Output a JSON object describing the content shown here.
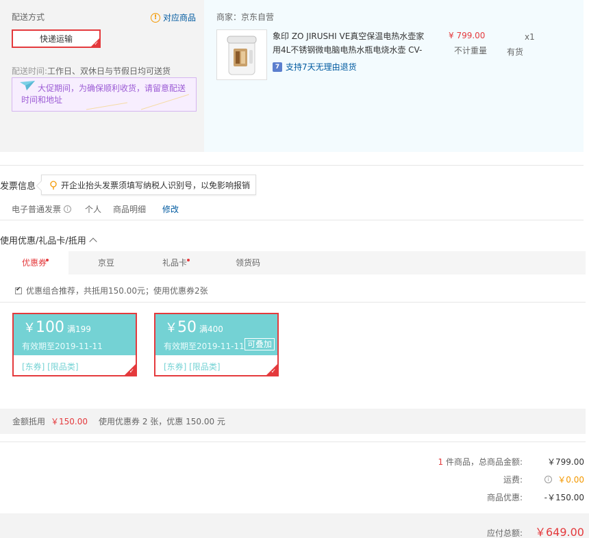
{
  "delivery": {
    "title": "配送方式",
    "match_link": "对应商品",
    "option": "快递运输",
    "time_label": "配送时间:",
    "time_value": "工作日、双休日与节假日均可送货",
    "promo_notice": "大促期间，为确保顺利收货，请留意配送时间和地址"
  },
  "product": {
    "seller": "商家：京东自营",
    "name": "象印 ZO JIRUSHI VE真空保温电热水壶家用4L不锈钢微电脑电热水瓶电烧水壶 CV-",
    "price": "¥ 799.00",
    "weight": "不计重量",
    "qty": "x1",
    "stock": "有货",
    "return_policy": "支持7天无理由退货",
    "return_badge": "7"
  },
  "invoice": {
    "title": "发票信息",
    "tip": "开企业抬头发票须填写纳税人识别号，以免影响报销",
    "type": "电子普通发票",
    "info_glyph": "i",
    "personal": "个人",
    "detail": "商品明细",
    "edit": "修改"
  },
  "coupons": {
    "title": "使用优惠/礼品卡/抵用",
    "tabs": [
      {
        "label": "优惠券",
        "active": true,
        "dot": true
      },
      {
        "label": "京豆",
        "active": false,
        "dot": false
      },
      {
        "label": "礼品卡",
        "active": false,
        "dot": true
      },
      {
        "label": "领货码",
        "active": false,
        "dot": false
      }
    ],
    "combo_text": "优惠组合推荐，共抵用150.00元；使用优惠券2张",
    "items": [
      {
        "yen": "￥",
        "amount": "100",
        "cond": "满199",
        "valid": "有效期至2019-11-11",
        "stack": "",
        "tags": "[东券]  [限品类]"
      },
      {
        "yen": "￥",
        "amount": "50",
        "cond": "满400",
        "valid": "有效期至2019-11-11",
        "stack": "可叠加",
        "tags": "[东券]  [限品类]"
      }
    ],
    "summary_label": "金额抵用",
    "summary_amount": "￥150.00",
    "summary_desc": "使用优惠券 2 张，优惠 150.00 元"
  },
  "totals": {
    "count": "1",
    "count_suffix": "件商品，总商品金额:",
    "goods_amount": "￥799.00",
    "freight_label": "运费:",
    "freight_value": "￥0.00",
    "discount_label": "商品优惠:",
    "discount_value": "-￥150.00",
    "payable_label": "应付总额:",
    "payable_value": "￥649.00"
  },
  "colors": {
    "accent": "#e4393c",
    "link": "#005aa0",
    "coupon": "#74d2d4",
    "promo": "#9c5cd5",
    "warn": "#f39800"
  }
}
